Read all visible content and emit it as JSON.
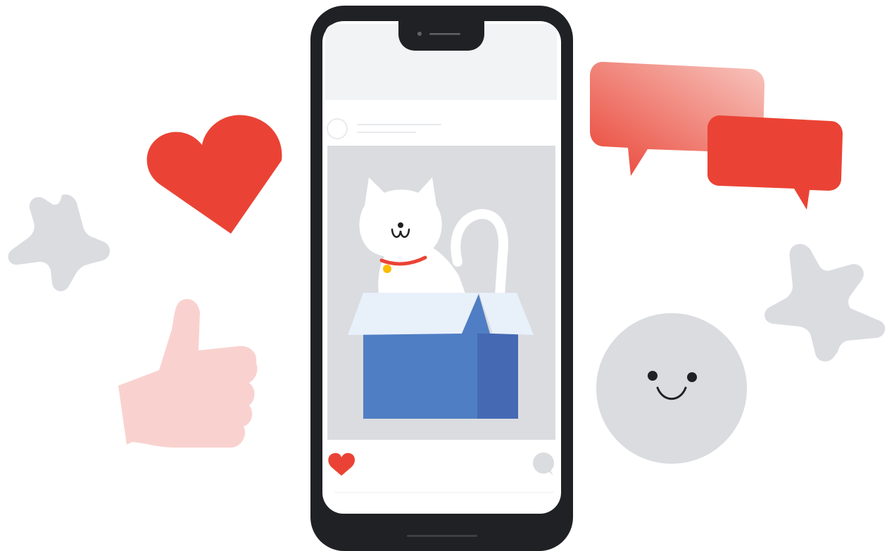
{
  "colors": {
    "red": "#ea4335",
    "red_light": "#f4a89f",
    "pink": "#f9d2cf",
    "gray": "#dadce0",
    "phone_body": "#202124",
    "screen_bg": "#ffffff",
    "header_bg": "#f1f3f4",
    "photo_bg": "#dadce0",
    "box_front": "#4f7ec4",
    "box_side": "#4569b3",
    "box_flap": "#e8f0fa",
    "cat": "#ffffff",
    "collar": "#ea4335",
    "bell": "#fbbc04"
  },
  "icons": {
    "heart": "heart-icon",
    "star": "star-icon",
    "thumbs_up": "thumbs-up-icon",
    "speech_bubble": "speech-bubble-icon",
    "smiley": "smiley-face-icon",
    "like": "heart-icon",
    "comment": "comment-icon",
    "avatar": "avatar-icon"
  }
}
